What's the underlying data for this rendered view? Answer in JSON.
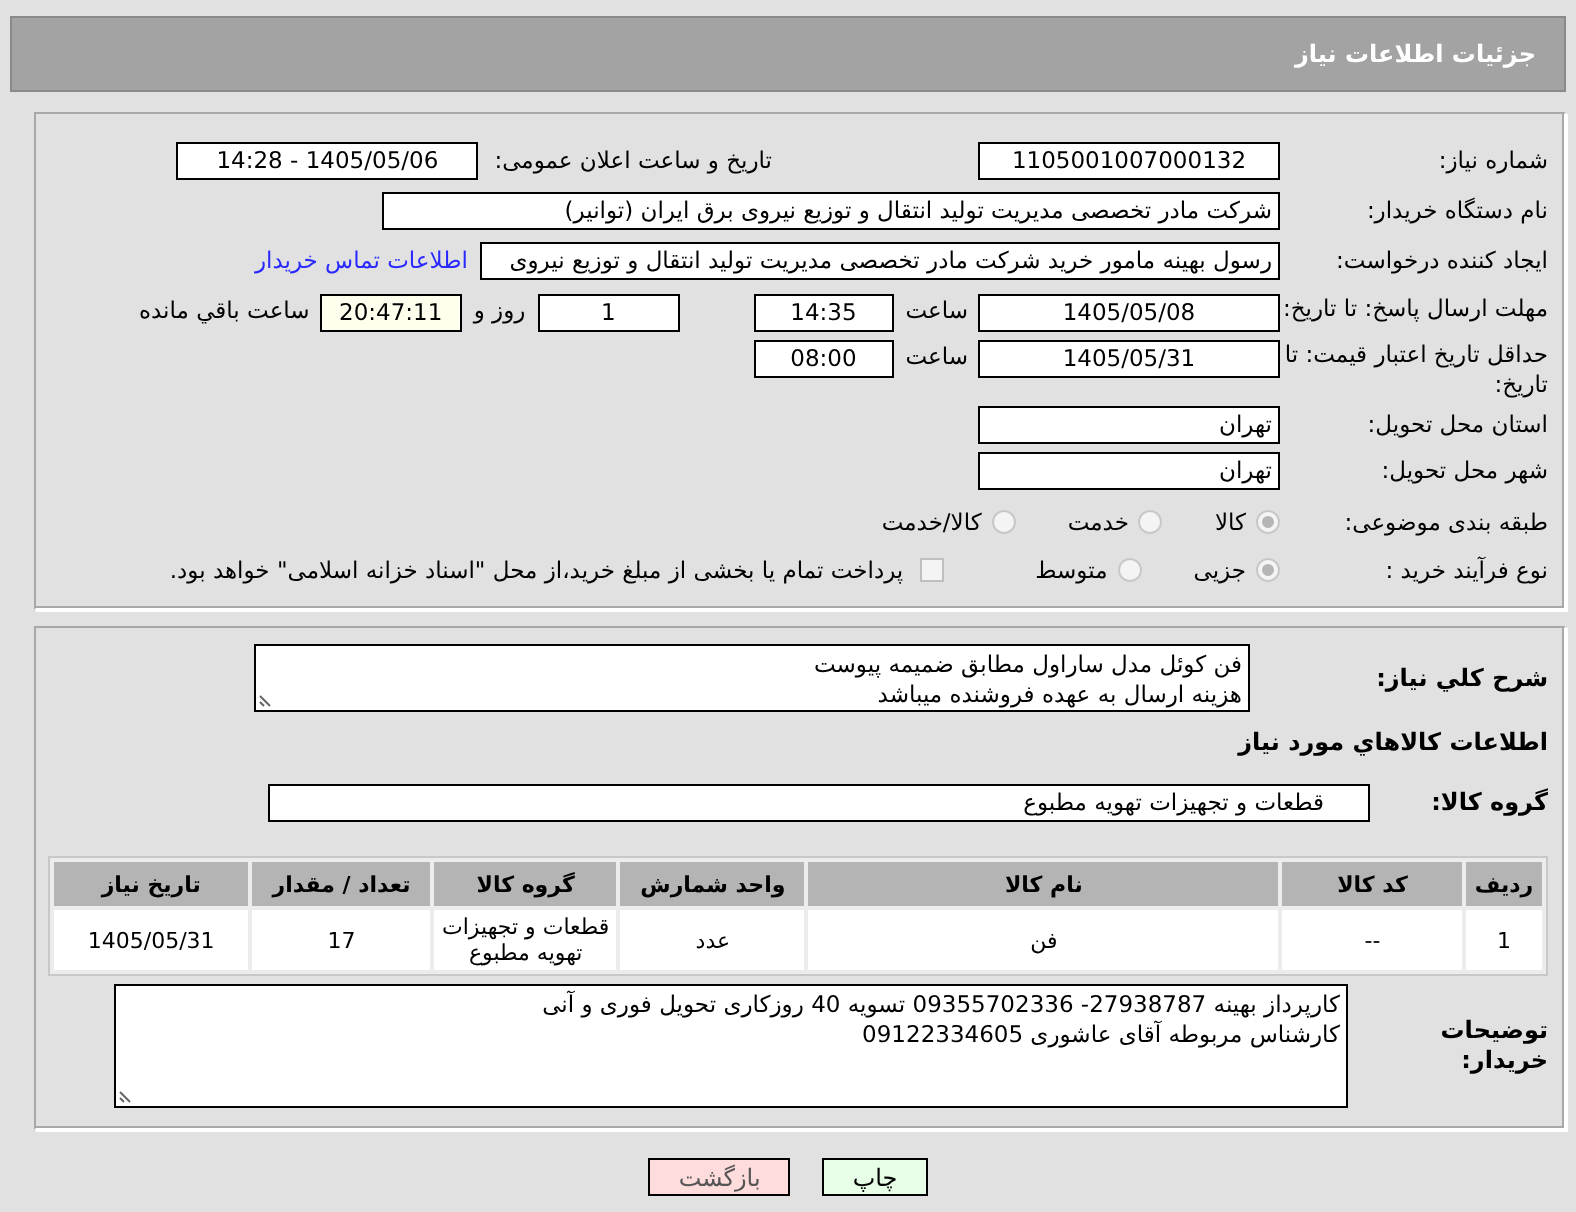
{
  "header": {
    "title": "جزئیات اطلاعات نیاز"
  },
  "need_number": {
    "label": "شماره نیاز:",
    "value": "1105001007000132"
  },
  "announce": {
    "label": "تاریخ و ساعت اعلان عمومی:",
    "value": "1405/05/06 - 14:28"
  },
  "buyer_org": {
    "label": "نام دستگاه خریدار:",
    "value": "شرکت مادر تخصصی مدیریت تولید  انتقال و توزیع نیروی برق ایران (توانیر)"
  },
  "requester": {
    "label": "ایجاد کننده درخواست:",
    "value": "رسول بهینه مامور خرید شرکت مادر تخصصی مدیریت تولید  انتقال و توزیع نیروی",
    "contact_link": "اطلاعات تماس خریدار"
  },
  "reply_deadline": {
    "label": "مهلت ارسال پاسخ: تا تاریخ:",
    "date": "1405/05/08",
    "time_label": "ساعت",
    "time": "14:35",
    "days": "1",
    "days_label": "روز و",
    "remaining": "20:47:11",
    "remaining_label": "ساعت باقي مانده"
  },
  "price_validity": {
    "label": "حداقل تاریخ اعتبار قیمت: تا تاریخ:",
    "date": "1405/05/31",
    "time_label": "ساعت",
    "time": "08:00"
  },
  "delivery_province": {
    "label": "استان محل تحویل:",
    "value": "تهران"
  },
  "delivery_city": {
    "label": "شهر محل تحویل:",
    "value": "تهران"
  },
  "category": {
    "label": "طبقه بندی موضوعی:",
    "options": [
      {
        "label": "کالا",
        "selected": true
      },
      {
        "label": "خدمت",
        "selected": false
      },
      {
        "label": "کالا/خدمت",
        "selected": false
      }
    ]
  },
  "purchase_type": {
    "label": "نوع فرآیند خرید :",
    "options": [
      {
        "label": "جزیی",
        "selected": true
      },
      {
        "label": "متوسط",
        "selected": false
      }
    ],
    "treasury": {
      "label": "پرداخت تمام یا بخشی از مبلغ خرید،از محل \"اسناد خزانه اسلامی\" خواهد بود.",
      "checked": false
    }
  },
  "description": {
    "label": "شرح کلي نياز:",
    "lines": [
      "فن کوئل مدل ساراول مطابق ضمیمه پیوست",
      "هزینه ارسال به عهده فروشنده میباشد"
    ]
  },
  "goods_section": {
    "title": "اطلاعات کالاهاي مورد نياز"
  },
  "goods_group": {
    "label": "گروه کالا:",
    "value": "قطعات و تجهیزات تهویه مطبوع"
  },
  "table": {
    "columns": [
      "ردیف",
      "کد کالا",
      "نام کالا",
      "واحد شمارش",
      "گروه کالا",
      "تعداد / مقدار",
      "تاریخ نیاز"
    ],
    "rows": [
      [
        "1",
        "--",
        "فن",
        "عدد",
        "قطعات و تجهیزات تهویه مطبوع",
        "17",
        "1405/05/31"
      ]
    ]
  },
  "buyer_notes": {
    "label": "توضیحات خریدار:",
    "lines": [
      "کارپرداز بهینه 27938787- 09355702336  تسویه 40 روزکاری تحویل فوری و آنی",
      "کارشناس مربوطه آقای عاشوری 09122334605"
    ]
  },
  "buttons": [
    {
      "label": "چاپ",
      "kind": "print"
    },
    {
      "label": "بازگشت",
      "kind": "back"
    }
  ]
}
